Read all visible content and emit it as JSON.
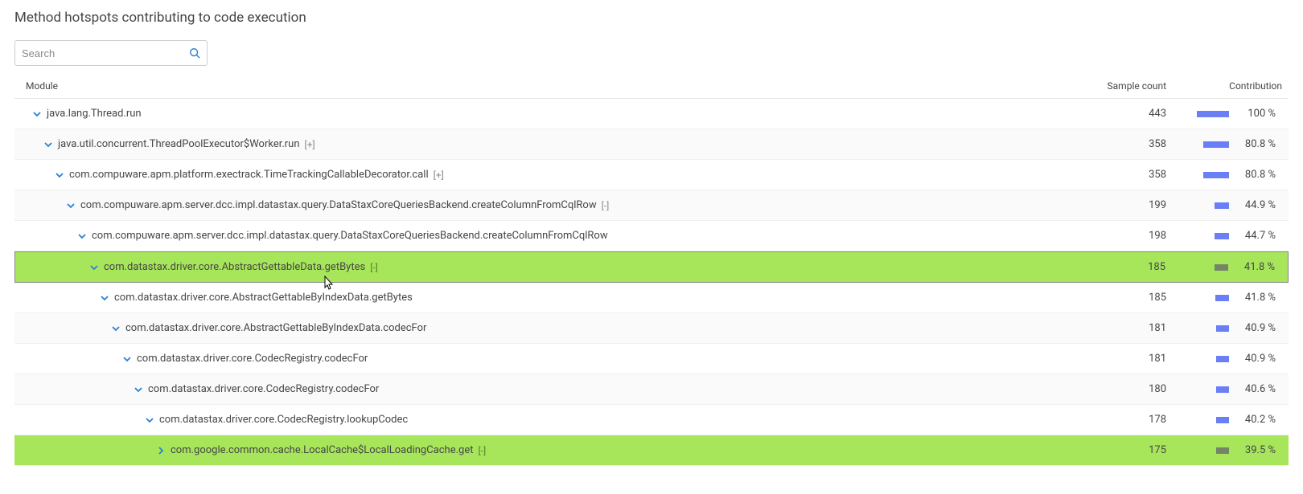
{
  "title": "Method hotspots contributing to code execution",
  "search": {
    "placeholder": "Search"
  },
  "headers": {
    "module": "Module",
    "sample_count": "Sample count",
    "contribution": "Contribution"
  },
  "colors": {
    "bar_normal": "#6a7ff5",
    "bar_highlight": "#748567",
    "highlight_bg": "#a7e65a"
  },
  "rows": [
    {
      "depth": 0,
      "expander": "down",
      "label": "java.lang.Thread.run",
      "suffix": "",
      "count": "443",
      "pct": "100 %",
      "bar": 40,
      "alt": false,
      "state": ""
    },
    {
      "depth": 1,
      "expander": "down",
      "label": "java.util.concurrent.ThreadPoolExecutor$Worker.run",
      "suffix": "[+]",
      "count": "358",
      "pct": "80.8 %",
      "bar": 32,
      "alt": true,
      "state": ""
    },
    {
      "depth": 2,
      "expander": "down",
      "label": "com.compuware.apm.platform.exectrack.TimeTrackingCallableDecorator.call",
      "suffix": "[+]",
      "count": "358",
      "pct": "80.8 %",
      "bar": 32,
      "alt": false,
      "state": ""
    },
    {
      "depth": 3,
      "expander": "down",
      "label": "com.compuware.apm.server.dcc.impl.datastax.query.DataStaxCoreQueriesBackend.createColumnFromCqlRow",
      "suffix": "[-]",
      "count": "199",
      "pct": "44.9 %",
      "bar": 18,
      "alt": true,
      "state": ""
    },
    {
      "depth": 4,
      "expander": "down",
      "label": "com.compuware.apm.server.dcc.impl.datastax.query.DataStaxCoreQueriesBackend.createColumnFromCqlRow",
      "suffix": "",
      "count": "198",
      "pct": "44.7 %",
      "bar": 18,
      "alt": false,
      "state": ""
    },
    {
      "depth": 5,
      "expander": "down",
      "label": "com.datastax.driver.core.AbstractGettableData.getBytes",
      "suffix": "[-]",
      "count": "185",
      "pct": "41.8 %",
      "bar": 17,
      "alt": false,
      "state": "selected"
    },
    {
      "depth": 6,
      "expander": "down",
      "label": "com.datastax.driver.core.AbstractGettableByIndexData.getBytes",
      "suffix": "",
      "count": "185",
      "pct": "41.8 %",
      "bar": 17,
      "alt": false,
      "state": ""
    },
    {
      "depth": 7,
      "expander": "down",
      "label": "com.datastax.driver.core.AbstractGettableByIndexData.codecFor",
      "suffix": "",
      "count": "181",
      "pct": "40.9 %",
      "bar": 16,
      "alt": true,
      "state": ""
    },
    {
      "depth": 8,
      "expander": "down",
      "label": "com.datastax.driver.core.CodecRegistry.codecFor",
      "suffix": "",
      "count": "181",
      "pct": "40.9 %",
      "bar": 16,
      "alt": false,
      "state": ""
    },
    {
      "depth": 9,
      "expander": "down",
      "label": "com.datastax.driver.core.CodecRegistry.codecFor",
      "suffix": "",
      "count": "180",
      "pct": "40.6 %",
      "bar": 16,
      "alt": true,
      "state": ""
    },
    {
      "depth": 10,
      "expander": "down",
      "label": "com.datastax.driver.core.CodecRegistry.lookupCodec",
      "suffix": "",
      "count": "178",
      "pct": "40.2 %",
      "bar": 16,
      "alt": false,
      "state": ""
    },
    {
      "depth": 11,
      "expander": "right",
      "label": "com.google.common.cache.LocalCache$LocalLoadingCache.get",
      "suffix": "[-]",
      "count": "175",
      "pct": "39.5 %",
      "bar": 16,
      "alt": false,
      "state": "highlight"
    }
  ]
}
